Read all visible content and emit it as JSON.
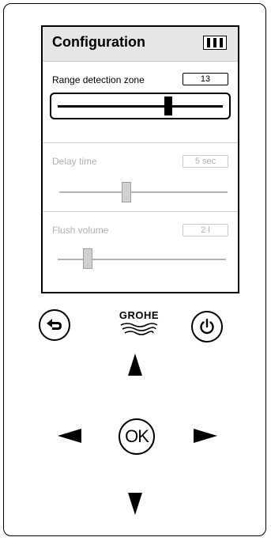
{
  "screen": {
    "title": "Configuration",
    "battery_icon": "battery-full-icon"
  },
  "settings": [
    {
      "label": "Range detection zone",
      "value": "13",
      "level": 0.67,
      "active": true
    },
    {
      "label": "Delay time",
      "value": "5 sec",
      "level": 0.4,
      "active": false
    },
    {
      "label": "Flush volume",
      "value": "2 l",
      "level": 0.18,
      "active": false
    }
  ],
  "controls": {
    "back_icon": "back-arrow-icon",
    "power_icon": "power-icon",
    "logo_text": "GROHE",
    "ok_label": "OK",
    "up_icon": "up-arrow-icon",
    "down_icon": "down-arrow-icon",
    "left_icon": "left-arrow-icon",
    "right_icon": "right-arrow-icon"
  }
}
